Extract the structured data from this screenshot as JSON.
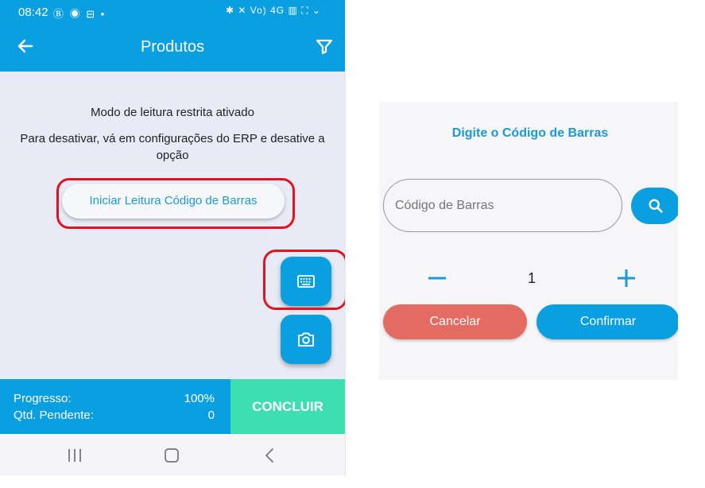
{
  "colors": {
    "primary": "#0a9fe0",
    "accent_green": "#3ddfb0",
    "cancel_red": "#e36b62",
    "highlight_red": "#e0141e",
    "content_bg": "#e8eaf5"
  },
  "status_bar": {
    "time": "08:42",
    "left_icons": "Ⓑ ◉ ⊟ •",
    "right_icons": "✱ ✕ Vo) 4G ▥ ⛶ ⌄"
  },
  "app_bar": {
    "title": "Produtos",
    "back_icon": "arrow-left-icon",
    "filter_icon": "filter-icon"
  },
  "content": {
    "message_line1": "Modo de leitura restrita ativado",
    "message_line2": "Para desativar, vá em configurações do ERP e desative a opção",
    "scan_button_label": "Iniciar Leitura Código de Barras",
    "fab_keyboard_icon": "keyboard-icon",
    "fab_camera_icon": "camera-icon"
  },
  "bottom_bar": {
    "progress_label": "Progresso:",
    "progress_value": "100%",
    "pending_label": "Qtd. Pendente:",
    "pending_value": "0",
    "conclude_label": "CONCLUIR"
  },
  "nav_bar": {
    "recent_icon": "recent-apps-icon",
    "home_icon": "home-icon",
    "back_icon": "back-chevron-icon"
  },
  "dialog": {
    "title": "Digite o Código de Barras",
    "barcode_placeholder": "Código de Barras",
    "search_icon": "search-icon",
    "quantity": "1",
    "cancel_label": "Cancelar",
    "confirm_label": "Confirmar"
  }
}
